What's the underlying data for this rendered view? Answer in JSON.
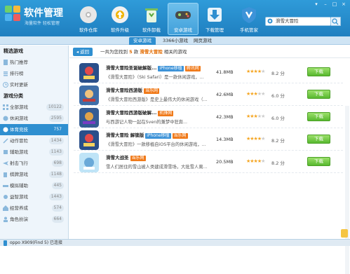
{
  "app": {
    "title": "软件管理",
    "subtitle": "海量软件 轻松管理"
  },
  "nav": [
    {
      "label": "软件仓库"
    },
    {
      "label": "软件升级"
    },
    {
      "label": "软件卸载"
    },
    {
      "label": "安卓游戏",
      "active": true
    },
    {
      "label": "下载管理"
    },
    {
      "label": "手机管家"
    }
  ],
  "search": {
    "value": "滑雪大冒险"
  },
  "subtabs": [
    {
      "label": "安卓游戏",
      "active": true
    },
    {
      "label": "3366小游戏"
    },
    {
      "label": "网页游戏"
    }
  ],
  "sidebar": {
    "section1": "精选游戏",
    "items1": [
      {
        "label": "热门推荐"
      },
      {
        "label": "排行榜"
      },
      {
        "label": "实时更新"
      }
    ],
    "section2": "游戏分类",
    "items2": [
      {
        "label": "全部游戏",
        "count": "10122"
      },
      {
        "label": "休闲游戏",
        "count": "2595"
      },
      {
        "label": "体育竞技",
        "count": "757",
        "active": true
      },
      {
        "label": "动作冒险",
        "count": "1434"
      },
      {
        "label": "辅助游戏",
        "count": "1143"
      },
      {
        "label": "射击飞行",
        "count": "698"
      },
      {
        "label": "棋牌游戏",
        "count": "1148"
      },
      {
        "label": "模拟辅助",
        "count": "445"
      },
      {
        "label": "益智游戏",
        "count": "1443"
      },
      {
        "label": "经营养成",
        "count": "574"
      },
      {
        "label": "角色扮演",
        "count": "664"
      }
    ]
  },
  "results": {
    "back_label": "返回",
    "prefix": "一共为您找到",
    "count": "5",
    "unit": "款",
    "keyword": "滑雪大冒险",
    "suffix": "相关的游戏"
  },
  "games": [
    {
      "name": "滑雪大冒险圣诞破解版...",
      "tag": "iPhone移植",
      "tag2": "腾讯网",
      "desc": "《滑雪大冒险》（Ski Safari）是一款休闲游戏，...",
      "size": "41.8MB",
      "stars": 4,
      "score": "8.2 分",
      "btn": "下载"
    },
    {
      "name": "滑雪大冒险西游版",
      "tag": "",
      "tag2": "当乐网",
      "desc": "《滑雪大冒险西游版》是史上最伟大的休闲游戏（...",
      "size": "42.6MB",
      "stars": 3,
      "score": "6.0 分",
      "btn": "下载"
    },
    {
      "name": "滑雪大冒险西游版破解...",
      "tag": "",
      "tag2": "机锋网",
      "desc": "与西游记人物一起在Sven的兼梦中狂奔...",
      "size": "42.3MB",
      "stars": 3,
      "score": "6.0 分",
      "btn": "下载"
    },
    {
      "name": "滑雪大冒险 解锁版",
      "tag": "iPhone移植",
      "tag2": "当乐网",
      "desc": "《滑雪大冒险》一款移植自iOS平台的休闲游戏，...",
      "size": "14.3MB",
      "stars": 4,
      "score": "8.2 分",
      "btn": "下载"
    },
    {
      "name": "滑雪大战圣",
      "tag": "",
      "tag2": "当乐网",
      "desc": "雪人们居住的雪山被人类建成滑雪场，大批雪人离...",
      "size": "20.5MB",
      "stars": 4,
      "score": "8.2 分",
      "btn": "下载"
    }
  ],
  "status": {
    "device": "oppo X909(Find 5) 已连接"
  },
  "colors": {
    "titlebar": "#2f9bd9",
    "accent": "#2f8fd0",
    "download": "#58b82f",
    "highlight": "#e26b00"
  }
}
